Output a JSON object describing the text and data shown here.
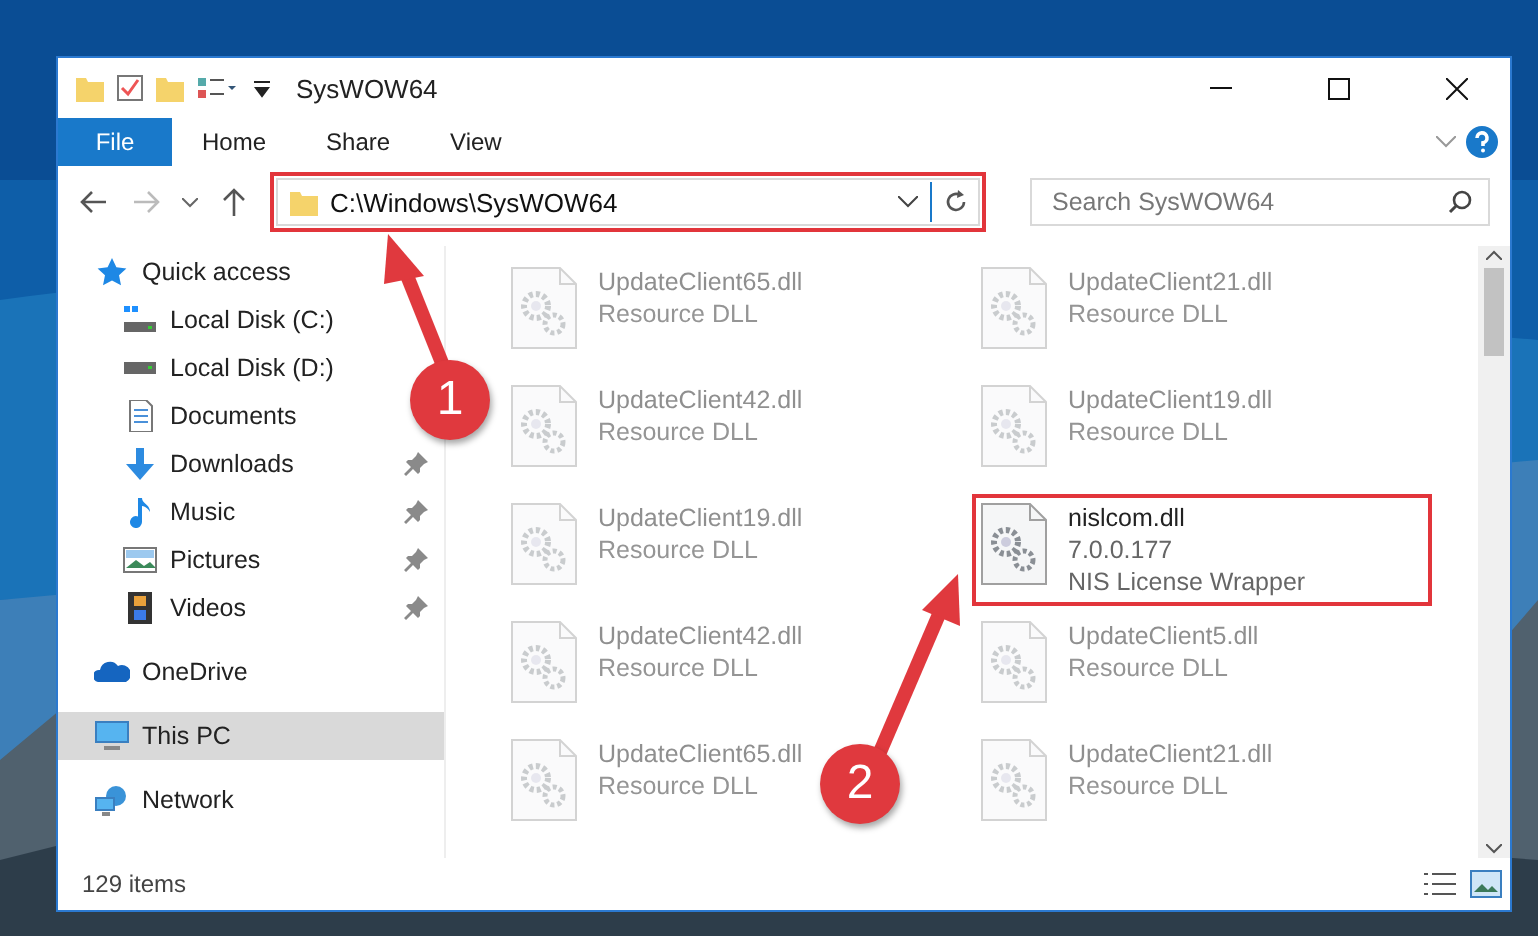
{
  "window": {
    "title": "SysWOW64"
  },
  "ribbon": {
    "tabs": [
      {
        "label": "File",
        "selected": true
      },
      {
        "label": "Home",
        "selected": false
      },
      {
        "label": "Share",
        "selected": false
      },
      {
        "label": "View",
        "selected": false
      }
    ]
  },
  "address": {
    "path": "C:\\Windows\\SysWOW64",
    "highlighted": true
  },
  "search": {
    "placeholder": "Search SysWOW64"
  },
  "sidebar": {
    "items": [
      {
        "label": "Quick access",
        "kind": "star",
        "selected": false,
        "children": [
          {
            "label": "Local Disk (C:)",
            "kind": "system-drive",
            "pinned": false
          },
          {
            "label": "Local Disk (D:)",
            "kind": "drive",
            "pinned": false
          },
          {
            "label": "Documents",
            "kind": "documents",
            "pinned": false
          },
          {
            "label": "Downloads",
            "kind": "downloads",
            "pinned": true
          },
          {
            "label": "Music",
            "kind": "music",
            "pinned": true
          },
          {
            "label": "Pictures",
            "kind": "pictures",
            "pinned": true
          },
          {
            "label": "Videos",
            "kind": "videos",
            "pinned": true
          }
        ]
      },
      {
        "label": "OneDrive",
        "kind": "cloud",
        "selected": false
      },
      {
        "label": "This PC",
        "kind": "computer",
        "selected": true
      },
      {
        "label": "Network",
        "kind": "network",
        "selected": false
      }
    ]
  },
  "files": [
    {
      "name": "UpdateClient65.dll",
      "details": [
        "Resource DLL"
      ],
      "faded": true,
      "highlighted": false
    },
    {
      "name": "UpdateClient21.dll",
      "details": [
        "Resource DLL"
      ],
      "faded": true,
      "highlighted": false
    },
    {
      "name": "UpdateClient42.dll",
      "details": [
        "Resource DLL"
      ],
      "faded": true,
      "highlighted": false
    },
    {
      "name": "UpdateClient19.dll",
      "details": [
        "Resource DLL"
      ],
      "faded": true,
      "highlighted": false
    },
    {
      "name": "UpdateClient19.dll",
      "details": [
        "Resource DLL"
      ],
      "faded": true,
      "highlighted": false
    },
    {
      "name": "nislcom.dll",
      "details": [
        "7.0.0.177",
        "NIS License Wrapper"
      ],
      "faded": false,
      "highlighted": true
    },
    {
      "name": "UpdateClient42.dll",
      "details": [
        "Resource DLL"
      ],
      "faded": true,
      "highlighted": false
    },
    {
      "name": "UpdateClient5.dll",
      "details": [
        "Resource DLL"
      ],
      "faded": true,
      "highlighted": false
    },
    {
      "name": "UpdateClient65.dll",
      "details": [
        "Resource DLL"
      ],
      "faded": true,
      "highlighted": false
    },
    {
      "name": "UpdateClient21.dll",
      "details": [
        "Resource DLL"
      ],
      "faded": true,
      "highlighted": false
    }
  ],
  "status_bar": {
    "item_count": "129 items"
  },
  "annotations": [
    {
      "number": "1"
    },
    {
      "number": "2"
    }
  ]
}
